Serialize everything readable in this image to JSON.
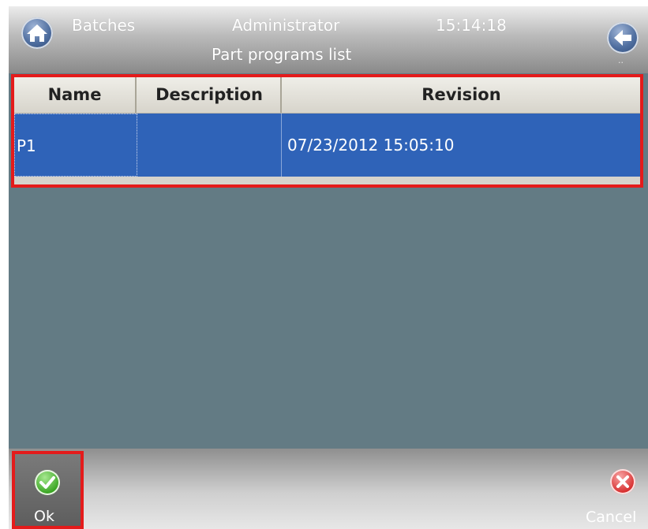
{
  "header": {
    "screen_name": "Batches",
    "user": "Administrator",
    "time": "15:14:18",
    "subtitle": "Part programs list",
    "back_hint": "..",
    "icons": {
      "home": "home-icon",
      "back": "arrow-left-icon"
    }
  },
  "table": {
    "columns": [
      "Name",
      "Description",
      "Revision"
    ],
    "rows": [
      {
        "name": "P1",
        "description": "",
        "revision": "07/23/2012 15:05:10"
      }
    ]
  },
  "footer": {
    "ok_label": "Ok",
    "cancel_label": "Cancel",
    "icons": {
      "ok": "checkmark-icon",
      "cancel": "x-icon"
    }
  },
  "colors": {
    "selection": "#2f63b8",
    "highlight_frame": "#e41b1b",
    "background": "#637b84"
  }
}
